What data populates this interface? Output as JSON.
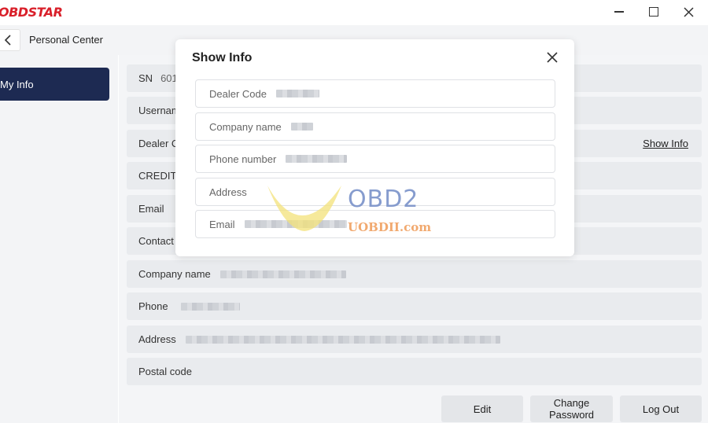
{
  "app": {
    "logo": "OBDSTAR"
  },
  "header": {
    "title": "Personal Center"
  },
  "sidebar": {
    "items": [
      {
        "label": "My Info"
      }
    ]
  },
  "info_rows": [
    {
      "label": "SN",
      "value": "601"
    },
    {
      "label": "Usernam"
    },
    {
      "label": "Dealer C"
    },
    {
      "label": "CREDIT I"
    },
    {
      "label": "Email"
    },
    {
      "label": "Contact"
    },
    {
      "label": "Company name"
    },
    {
      "label": "Phone"
    },
    {
      "label": "Address"
    },
    {
      "label": "Postal code"
    }
  ],
  "show_info_link": "Show Info",
  "buttons": {
    "edit": "Edit",
    "change_password": "Change Password",
    "log_out": "Log Out"
  },
  "modal": {
    "title": "Show Info",
    "fields": [
      {
        "label": "Dealer Code"
      },
      {
        "label": "Company name"
      },
      {
        "label": "Phone number"
      },
      {
        "label": "Address"
      },
      {
        "label": "Email"
      }
    ]
  },
  "watermark": {
    "line1": "OBD2",
    "line2": "UOBDII.com"
  },
  "colors": {
    "brand": "#d9202a",
    "sidebar_active": "#1d2a52"
  }
}
